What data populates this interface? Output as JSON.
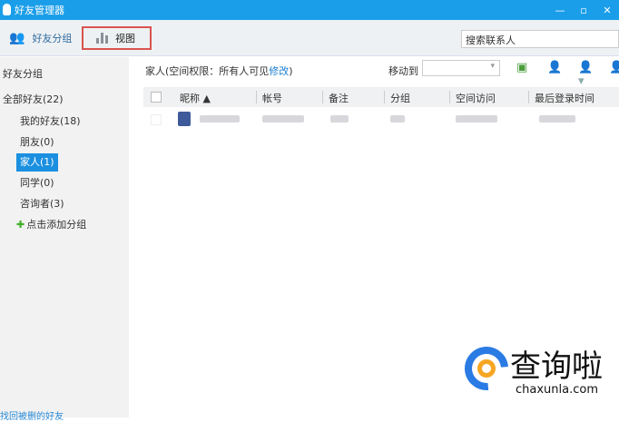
{
  "window": {
    "title": "好友管理器",
    "controls": [
      "minimize",
      "maximize",
      "close"
    ]
  },
  "toolbar": {
    "friend_groups": "好友分组",
    "view": "视图",
    "search_placeholder": "搜索联系人"
  },
  "sidebar": {
    "header": "好友分组",
    "items": [
      {
        "label": "全部好友(22)"
      },
      {
        "label": "我的好友(18)"
      },
      {
        "label": "朋友(0)"
      },
      {
        "label": "家人(1)",
        "selected": true
      },
      {
        "label": "同学(0)"
      },
      {
        "label": "咨询者(3)"
      }
    ],
    "add_group": "点击添加分组",
    "recover": "找回被删的好友"
  },
  "main": {
    "caption_prefix": "家人(空间权限：所有人可见",
    "caption_link": "修改",
    "caption_suffix": ")",
    "move_to": "移动到",
    "columns": [
      "昵称 ▲",
      "帐号",
      "备注",
      "分组",
      "空间访问",
      "最后登录时间"
    ]
  },
  "watermark": {
    "text": "查询啦",
    "url": "chaxunla.com"
  },
  "colors": {
    "accent": "#1b9ee9",
    "selected": "#1b8fe0",
    "highlight_border": "#d9534f"
  }
}
